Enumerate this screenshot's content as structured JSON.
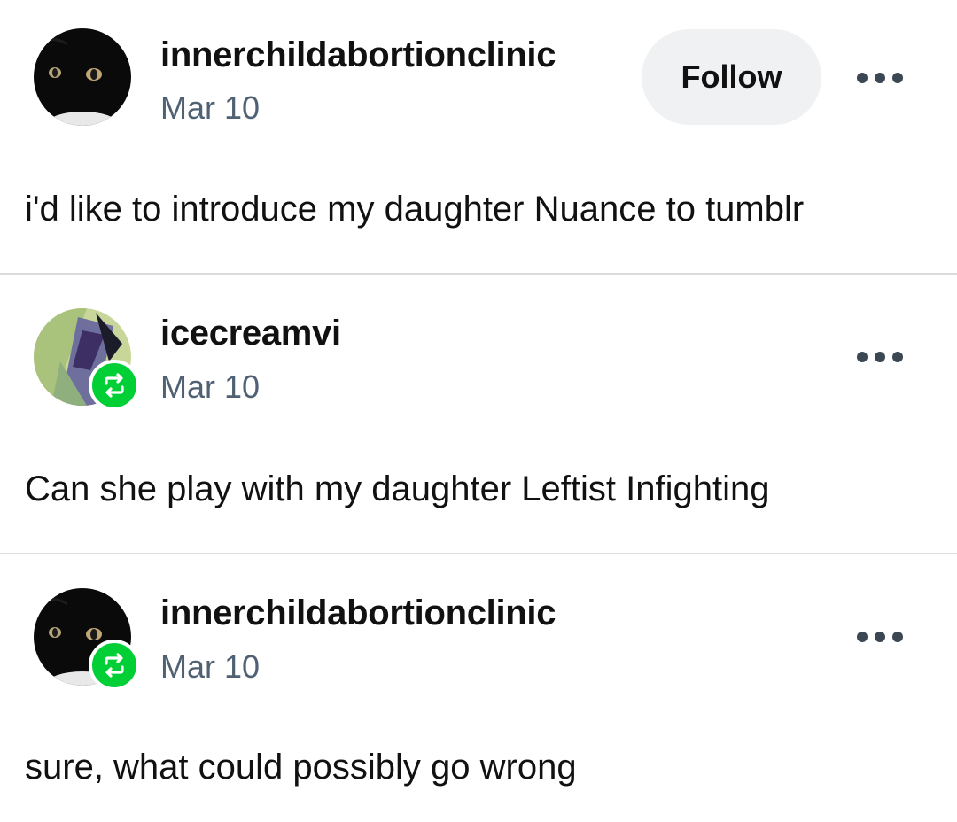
{
  "posts": [
    {
      "username": "innerchildabortionclinic",
      "date": "Mar 10",
      "follow_label": "Follow",
      "more_icon": "more-horizontal-icon",
      "body": "i'd like to introduce my daughter Nuance to tumblr",
      "avatar": "black-cat-avatar"
    },
    {
      "username": "icecreamvi",
      "date": "Mar 10",
      "more_icon": "more-horizontal-icon",
      "reblog_icon": "reblog-icon",
      "body": "Can she play with my daughter Leftist Infighting",
      "avatar": "illustrated-avatar"
    },
    {
      "username": "innerchildabortionclinic",
      "date": "Mar 10",
      "more_icon": "more-horizontal-icon",
      "reblog_icon": "reblog-icon",
      "body": "sure, what could possibly go wrong",
      "avatar": "black-cat-avatar"
    }
  ],
  "colors": {
    "reblog_green": "#00cf35",
    "date_gray": "#4f6172",
    "follow_bg": "#eff1f3",
    "divider": "#dcdcdc"
  }
}
